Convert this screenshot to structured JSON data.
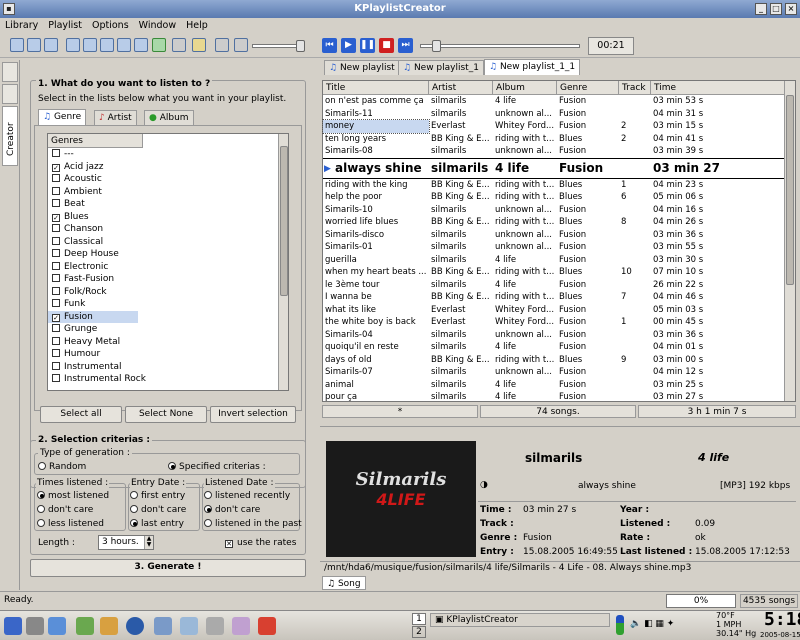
{
  "window": {
    "title": "KPlaylistCreator"
  },
  "menu": [
    "Library",
    "Playlist",
    "Options",
    "Window",
    "Help"
  ],
  "player": {
    "time": "00:21"
  },
  "sidebar": {
    "tab_label": "Creator"
  },
  "left": {
    "section1": "1. What do you want to listen to ?",
    "subtitle": "Select in the lists below what you want in your playlist.",
    "tabs": [
      "Genre",
      "Artist",
      "Album"
    ],
    "genres_header": "Genres",
    "genres": [
      {
        "name": "---",
        "checked": false
      },
      {
        "name": "Acid jazz",
        "checked": true
      },
      {
        "name": "Acoustic",
        "checked": false
      },
      {
        "name": "Ambient",
        "checked": false
      },
      {
        "name": "Beat",
        "checked": false
      },
      {
        "name": "Blues",
        "checked": true
      },
      {
        "name": "Chanson",
        "checked": false
      },
      {
        "name": "Classical",
        "checked": false
      },
      {
        "name": "Deep House",
        "checked": false
      },
      {
        "name": "Electronic",
        "checked": false
      },
      {
        "name": "Fast-Fusion",
        "checked": false
      },
      {
        "name": "Folk/Rock",
        "checked": false
      },
      {
        "name": "Funk",
        "checked": false
      },
      {
        "name": "Fusion",
        "checked": true
      },
      {
        "name": "Grunge",
        "checked": false
      },
      {
        "name": "Heavy Metal",
        "checked": false
      },
      {
        "name": "Humour",
        "checked": false
      },
      {
        "name": "Instrumental",
        "checked": false
      },
      {
        "name": "Instrumental Rock",
        "checked": false
      }
    ],
    "buttons": {
      "select_all": "Select all",
      "select_none": "Select None",
      "invert": "Invert selection"
    },
    "section2": "2. Selection criterias :",
    "type_gen": "Type of generation :",
    "random": "Random",
    "specified": "Specified criterias :",
    "times_title": "Times listened :",
    "times": [
      "most listened",
      "don't care",
      "less listened"
    ],
    "entry_title": "Entry Date :",
    "entry": [
      "first entry",
      "don't care",
      "last entry"
    ],
    "listened_title": "Listened Date :",
    "listened": [
      "listened recently",
      "don't care",
      "listened in the past"
    ],
    "length_label": "Length :",
    "length_value": "3 hours.",
    "use_rates": "use the rates",
    "generate": "3. Generate !"
  },
  "playlists": {
    "tabs": [
      "New playlist",
      "New playlist_1",
      "New playlist_1_1"
    ],
    "columns": [
      "Title",
      "Artist",
      "Album",
      "Genre",
      "Track",
      "Time"
    ],
    "rows": [
      [
        "on n'est pas comme ça",
        "silmarils",
        "4 life",
        "Fusion",
        "",
        "03 min 53 s"
      ],
      [
        "Simarils-11",
        "silmarils",
        "unknown al...",
        "Fusion",
        "",
        "04 min 31 s"
      ],
      [
        "money",
        "Everlast",
        "Whitey Ford...",
        "Fusion",
        "2",
        "03 min 15 s"
      ],
      [
        "ten long years",
        "BB King & E...",
        "riding with t...",
        "Blues",
        "2",
        "04 min 41 s"
      ],
      [
        "Simarils-08",
        "silmarils",
        "unknown al...",
        "Fusion",
        "",
        "03 min 39 s"
      ],
      [
        "always shine",
        "silmarils",
        "4 life",
        "Fusion",
        "",
        "03 min 27"
      ],
      [
        "riding with the king",
        "BB King & E...",
        "riding with t...",
        "Blues",
        "1",
        "04 min 23 s"
      ],
      [
        "help the poor",
        "BB King & E...",
        "riding with t...",
        "Blues",
        "6",
        "05 min 06 s"
      ],
      [
        "Simarils-10",
        "silmarils",
        "unknown al...",
        "Fusion",
        "",
        "04 min 16 s"
      ],
      [
        "worried life blues",
        "BB King & E...",
        "riding with t...",
        "Blues",
        "8",
        "04 min 26 s"
      ],
      [
        "Simarils-disco",
        "silmarils",
        "unknown al...",
        "Fusion",
        "",
        "03 min 36 s"
      ],
      [
        "Simarils-01",
        "silmarils",
        "unknown al...",
        "Fusion",
        "",
        "03 min 55 s"
      ],
      [
        "guerilla",
        "silmarils",
        "4 life",
        "Fusion",
        "",
        "03 min 30 s"
      ],
      [
        "when my heart beats ...",
        "BB King & E...",
        "riding with t...",
        "Blues",
        "10",
        "07 min 10 s"
      ],
      [
        "le 3ème tour",
        "silmarils",
        "4 life",
        "Fusion",
        "",
        "26 min 22 s"
      ],
      [
        "I wanna be",
        "BB King & E...",
        "riding with t...",
        "Blues",
        "7",
        "04 min 46 s"
      ],
      [
        "what its like",
        "Everlast",
        "Whitey Ford...",
        "Fusion",
        "",
        "05 min 03 s"
      ],
      [
        "the white boy is back",
        "Everlast",
        "Whitey Ford...",
        "Fusion",
        "1",
        "00 min 45 s"
      ],
      [
        "Simarils-04",
        "silmarils",
        "unknown al...",
        "Fusion",
        "",
        "03 min 36 s"
      ],
      [
        "quoiqu'il en reste",
        "silmarils",
        "4 life",
        "Fusion",
        "",
        "04 min 01 s"
      ],
      [
        "days of old",
        "BB King & E...",
        "riding with t...",
        "Blues",
        "9",
        "03 min 00 s"
      ],
      [
        "Simarils-07",
        "silmarils",
        "unknown al...",
        "Fusion",
        "",
        "04 min 12 s"
      ],
      [
        "animal",
        "silmarils",
        "4 life",
        "Fusion",
        "",
        "03 min 25 s"
      ],
      [
        "pour ça",
        "silmarils",
        "4 life",
        "Fusion",
        "",
        "03 min 27 s"
      ]
    ],
    "footer": {
      "marker": "*",
      "songs": "74  songs.",
      "duration": "3 h 1 min 7 s"
    }
  },
  "song": {
    "cover_text": "Silmarils",
    "cover_sub": "4LIFE",
    "artist": "silmarils",
    "album": "4 life",
    "title": "always shine",
    "format": "[MP3]  192  kbps",
    "labels": {
      "time": "Time :",
      "track": "Track :",
      "genre": "Genre :",
      "entry": "Entry :",
      "year": "Year :",
      "listened": "Listened :",
      "rate": "Rate :",
      "last": "Last listened :"
    },
    "values": {
      "time": "03 min 27 s",
      "track": "",
      "genre": "Fusion",
      "entry": "15.08.2005 16:49:55",
      "year": "",
      "listened": "0.09",
      "rate": "ok",
      "last": "15.08.2005 17:12:53"
    },
    "path": "/mnt/hda6/musique/fusion/silmarils/4 life/Silmarils - 4 Life - 08. Always shine.mp3",
    "tab": "Song"
  },
  "status": {
    "ready": "Ready.",
    "percent": "0%",
    "songs": "4535 songs"
  },
  "taskbar": {
    "desktops": [
      "1",
      "2"
    ],
    "app": "KPlaylistCreator",
    "weather": "70°F",
    "wind": "1 MPH",
    "pressure": "30.14\" Hg",
    "clock": "5:18",
    "date": "2005-08-15"
  },
  "colors": {
    "accent": "#2a5fd0",
    "selection": "#c8d8f0"
  }
}
